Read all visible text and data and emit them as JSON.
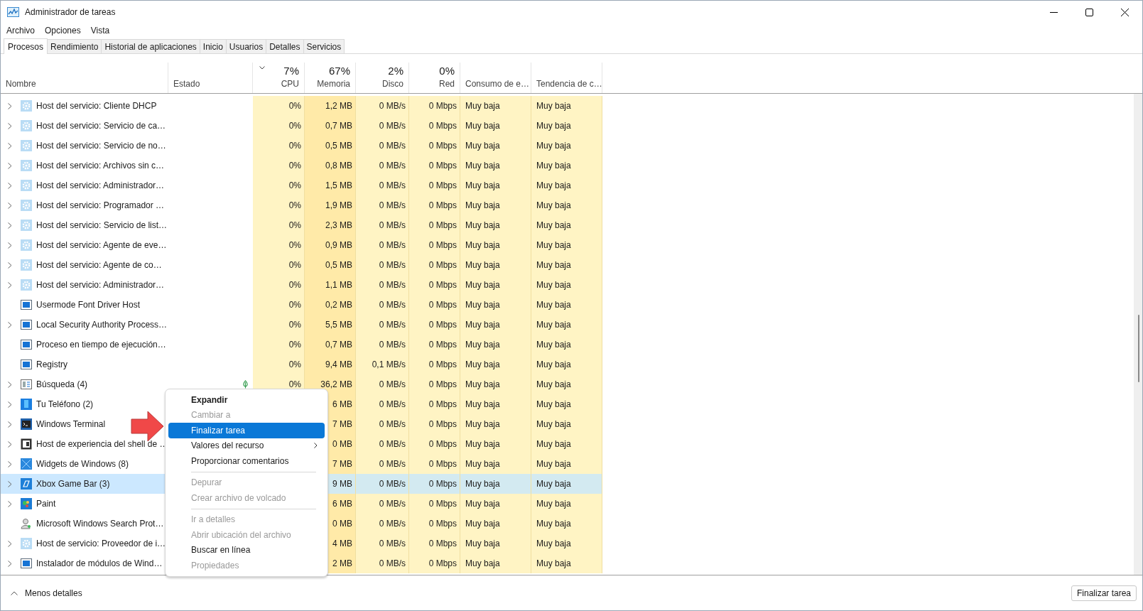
{
  "window": {
    "title": "Administrador de tareas"
  },
  "menu": [
    "Archivo",
    "Opciones",
    "Vista"
  ],
  "tabs": [
    {
      "label": "Procesos",
      "selected": true
    },
    {
      "label": "Rendimiento",
      "selected": false
    },
    {
      "label": "Historial de aplicaciones",
      "selected": false
    },
    {
      "label": "Inicio",
      "selected": false
    },
    {
      "label": "Usuarios",
      "selected": false
    },
    {
      "label": "Detalles",
      "selected": false
    },
    {
      "label": "Servicios",
      "selected": false
    }
  ],
  "columns": [
    {
      "label": "Nombre",
      "sorted": false
    },
    {
      "label": "Estado",
      "sorted": false
    },
    {
      "label": "CPU",
      "total": "7%",
      "sorted": true
    },
    {
      "label": "Memoria",
      "total": "67%",
      "sorted": false
    },
    {
      "label": "Disco",
      "total": "2%",
      "sorted": false
    },
    {
      "label": "Red",
      "total": "0%",
      "sorted": false
    },
    {
      "label": "Consumo de e…",
      "sorted": false
    },
    {
      "label": "Tendencia de c…",
      "sorted": false
    }
  ],
  "rows": [
    {
      "name": "Host del servicio: Cliente DHCP",
      "kind": "service",
      "expandable": true,
      "selected": false,
      "eco": false,
      "cpu": "0%",
      "memory": "1,2 MB",
      "disk": "0 MB/s",
      "network": "0 Mbps",
      "power": "Muy baja",
      "trend": "Muy baja"
    },
    {
      "name": "Host del servicio: Servicio de ca…",
      "kind": "service",
      "expandable": true,
      "selected": false,
      "eco": false,
      "cpu": "0%",
      "memory": "0,7 MB",
      "disk": "0 MB/s",
      "network": "0 Mbps",
      "power": "Muy baja",
      "trend": "Muy baja"
    },
    {
      "name": "Host del servicio: Servicio de no…",
      "kind": "service",
      "expandable": true,
      "selected": false,
      "eco": false,
      "cpu": "0%",
      "memory": "0,5 MB",
      "disk": "0 MB/s",
      "network": "0 Mbps",
      "power": "Muy baja",
      "trend": "Muy baja"
    },
    {
      "name": "Host del servicio: Archivos sin c…",
      "kind": "service",
      "expandable": true,
      "selected": false,
      "eco": false,
      "cpu": "0%",
      "memory": "0,8 MB",
      "disk": "0 MB/s",
      "network": "0 Mbps",
      "power": "Muy baja",
      "trend": "Muy baja"
    },
    {
      "name": "Host del servicio: Administrador…",
      "kind": "service",
      "expandable": true,
      "selected": false,
      "eco": false,
      "cpu": "0%",
      "memory": "1,5 MB",
      "disk": "0 MB/s",
      "network": "0 Mbps",
      "power": "Muy baja",
      "trend": "Muy baja"
    },
    {
      "name": "Host del servicio: Programador …",
      "kind": "service",
      "expandable": true,
      "selected": false,
      "eco": false,
      "cpu": "0%",
      "memory": "1,9 MB",
      "disk": "0 MB/s",
      "network": "0 Mbps",
      "power": "Muy baja",
      "trend": "Muy baja"
    },
    {
      "name": "Host del servicio: Servicio de list…",
      "kind": "service",
      "expandable": true,
      "selected": false,
      "eco": false,
      "cpu": "0%",
      "memory": "2,3 MB",
      "disk": "0 MB/s",
      "network": "0 Mbps",
      "power": "Muy baja",
      "trend": "Muy baja"
    },
    {
      "name": "Host del servicio: Agente de eve…",
      "kind": "service",
      "expandable": true,
      "selected": false,
      "eco": false,
      "cpu": "0%",
      "memory": "0,9 MB",
      "disk": "0 MB/s",
      "network": "0 Mbps",
      "power": "Muy baja",
      "trend": "Muy baja"
    },
    {
      "name": "Host del servicio: Agente de co…",
      "kind": "service",
      "expandable": true,
      "selected": false,
      "eco": false,
      "cpu": "0%",
      "memory": "0,5 MB",
      "disk": "0 MB/s",
      "network": "0 Mbps",
      "power": "Muy baja",
      "trend": "Muy baja"
    },
    {
      "name": "Host del servicio: Administrador…",
      "kind": "service",
      "expandable": true,
      "selected": false,
      "eco": false,
      "cpu": "0%",
      "memory": "1,1 MB",
      "disk": "0 MB/s",
      "network": "0 Mbps",
      "power": "Muy baja",
      "trend": "Muy baja"
    },
    {
      "name": "Usermode Font Driver Host",
      "kind": "process",
      "expandable": false,
      "selected": false,
      "eco": false,
      "cpu": "0%",
      "memory": "0,2 MB",
      "disk": "0 MB/s",
      "network": "0 Mbps",
      "power": "Muy baja",
      "trend": "Muy baja"
    },
    {
      "name": "Local Security Authority Process…",
      "kind": "process",
      "expandable": true,
      "selected": false,
      "eco": false,
      "cpu": "0%",
      "memory": "5,5 MB",
      "disk": "0 MB/s",
      "network": "0 Mbps",
      "power": "Muy baja",
      "trend": "Muy baja"
    },
    {
      "name": "Proceso en tiempo de ejecución…",
      "kind": "process",
      "expandable": false,
      "selected": false,
      "eco": false,
      "cpu": "0%",
      "memory": "0,7 MB",
      "disk": "0 MB/s",
      "network": "0 Mbps",
      "power": "Muy baja",
      "trend": "Muy baja"
    },
    {
      "name": "Registry",
      "kind": "process",
      "expandable": false,
      "selected": false,
      "eco": false,
      "cpu": "0%",
      "memory": "9,4 MB",
      "disk": "0,1 MB/s",
      "network": "0 Mbps",
      "power": "Muy baja",
      "trend": "Muy baja"
    },
    {
      "name": "Búsqueda (4)",
      "kind": "search",
      "expandable": true,
      "selected": false,
      "eco": true,
      "cpu": "0%",
      "memory": "36,2 MB",
      "disk": "0 MB/s",
      "network": "0 Mbps",
      "power": "Muy baja",
      "trend": "Muy baja"
    },
    {
      "name": "Tu Teléfono (2)",
      "kind": "phone",
      "expandable": true,
      "selected": false,
      "eco": false,
      "memory": "6 MB",
      "disk": "0 MB/s",
      "network": "0 Mbps",
      "power": "Muy baja",
      "trend": "Muy baja"
    },
    {
      "name": "Windows Terminal",
      "kind": "terminal",
      "expandable": true,
      "selected": false,
      "eco": false,
      "memory": "7 MB",
      "disk": "0 MB/s",
      "network": "0 Mbps",
      "power": "Muy baja",
      "trend": "Muy baja"
    },
    {
      "name": "Host de experiencia del shell de …",
      "kind": "shell",
      "expandable": true,
      "selected": false,
      "eco": false,
      "memory": "0 MB",
      "disk": "0 MB/s",
      "network": "0 Mbps",
      "power": "Muy baja",
      "trend": "Muy baja"
    },
    {
      "name": "Widgets de Windows (8)",
      "kind": "widgets",
      "expandable": true,
      "selected": false,
      "eco": false,
      "memory": "7 MB",
      "disk": "0 MB/s",
      "network": "0 Mbps",
      "power": "Muy baja",
      "trend": "Muy baja"
    },
    {
      "name": "Xbox Game Bar (3)",
      "kind": "gamebar",
      "expandable": true,
      "selected": true,
      "eco": false,
      "memory": "9 MB",
      "disk": "0 MB/s",
      "network": "0 Mbps",
      "power": "Muy baja",
      "trend": "Muy baja"
    },
    {
      "name": "Paint",
      "kind": "paint",
      "expandable": true,
      "selected": false,
      "eco": false,
      "memory": "6 MB",
      "disk": "0 MB/s",
      "network": "0 Mbps",
      "power": "Muy baja",
      "trend": "Muy baja"
    },
    {
      "name": "Microsoft Windows Search Prot…",
      "kind": "user",
      "expandable": false,
      "selected": false,
      "eco": false,
      "memory": "0 MB",
      "disk": "0 MB/s",
      "network": "0 Mbps",
      "power": "Muy baja",
      "trend": "Muy baja"
    },
    {
      "name": "Host de servicio: Proveedor de i…",
      "kind": "service",
      "expandable": true,
      "selected": false,
      "eco": false,
      "memory": "4 MB",
      "disk": "0 MB/s",
      "network": "0 Mbps",
      "power": "Muy baja",
      "trend": "Muy baja"
    },
    {
      "name": "Instalador de módulos de Wind…",
      "kind": "process",
      "expandable": true,
      "selected": false,
      "eco": false,
      "memory": "2 MB",
      "disk": "0 MB/s",
      "network": "0 Mbps",
      "power": "Muy baja",
      "trend": "Muy baja"
    }
  ],
  "context_menu": [
    {
      "kind": "item",
      "label": "Expandir",
      "default": true,
      "disabled": false,
      "selected": false,
      "submenu": false
    },
    {
      "kind": "item",
      "label": "Cambiar a",
      "default": false,
      "disabled": true,
      "selected": false,
      "submenu": false
    },
    {
      "kind": "item",
      "label": "Finalizar tarea",
      "default": false,
      "disabled": false,
      "selected": true,
      "submenu": false
    },
    {
      "kind": "item",
      "label": "Valores del recurso",
      "default": false,
      "disabled": false,
      "selected": false,
      "submenu": true
    },
    {
      "kind": "item",
      "label": "Proporcionar comentarios",
      "default": false,
      "disabled": false,
      "selected": false,
      "submenu": false
    },
    {
      "kind": "separator"
    },
    {
      "kind": "item",
      "label": "Depurar",
      "default": false,
      "disabled": true,
      "selected": false,
      "submenu": false
    },
    {
      "kind": "item",
      "label": "Crear archivo de volcado",
      "default": false,
      "disabled": true,
      "selected": false,
      "submenu": false
    },
    {
      "kind": "separator"
    },
    {
      "kind": "item",
      "label": "Ir a detalles",
      "default": false,
      "disabled": true,
      "selected": false,
      "submenu": false
    },
    {
      "kind": "item",
      "label": "Abrir ubicación del archivo",
      "default": false,
      "disabled": true,
      "selected": false,
      "submenu": false
    },
    {
      "kind": "item",
      "label": "Buscar en línea",
      "default": false,
      "disabled": false,
      "selected": false,
      "submenu": false
    },
    {
      "kind": "item",
      "label": "Propiedades",
      "default": false,
      "disabled": true,
      "selected": false,
      "submenu": false
    }
  ],
  "footer": {
    "toggle": "Menos detalles",
    "end_task_button": "Finalizar tarea"
  }
}
